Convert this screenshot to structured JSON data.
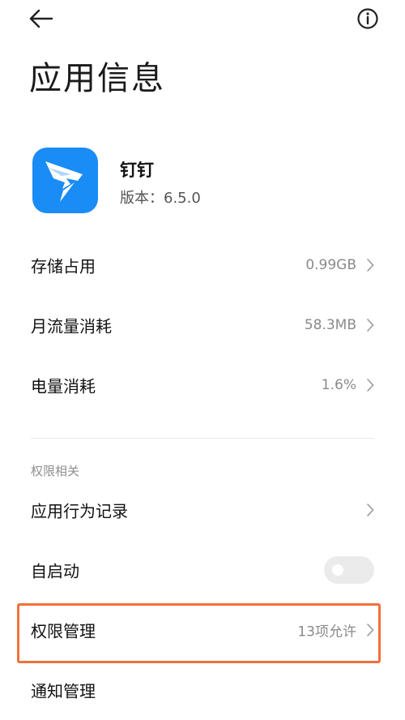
{
  "header": {
    "back_icon": "arrow-left-icon",
    "info_icon": "info-circle-icon",
    "title": "应用信息"
  },
  "app": {
    "name": "钉钉",
    "version": "版本：6.5.0",
    "logo_color": "#1a8cf5"
  },
  "usage": [
    {
      "label": "存储占用",
      "value": "0.99GB"
    },
    {
      "label": "月流量消耗",
      "value": "58.3MB"
    },
    {
      "label": "电量消耗",
      "value": "1.6%"
    }
  ],
  "permissions": {
    "section_title": "权限相关",
    "behavior_record": {
      "label": "应用行为记录"
    },
    "autostart": {
      "label": "自启动",
      "enabled": false
    },
    "permission_mgmt": {
      "label": "权限管理",
      "value": "13项允许"
    },
    "notification_mgmt": {
      "label": "通知管理"
    }
  },
  "highlight_color": "#f0713a"
}
